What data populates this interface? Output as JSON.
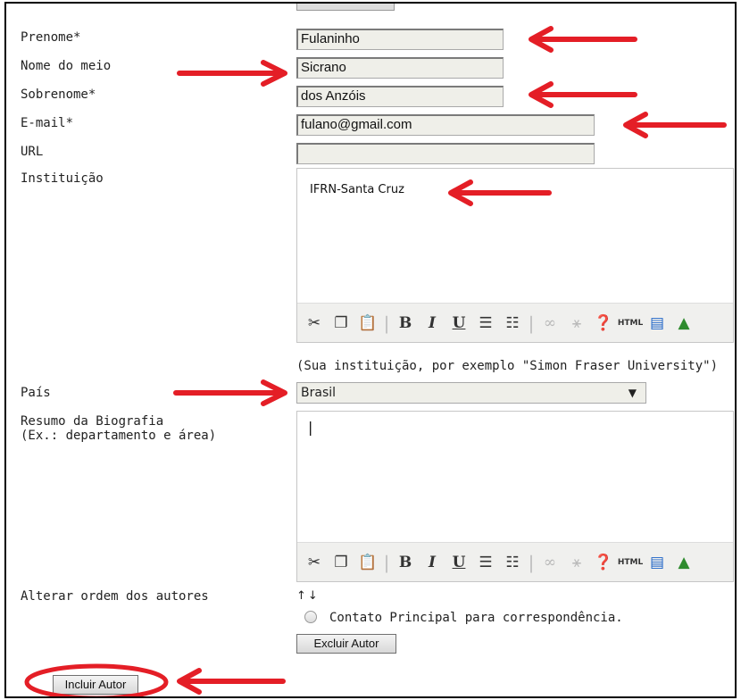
{
  "fields": {
    "prenome": {
      "label": "Prenome*",
      "value": "Fulaninho"
    },
    "nome_meio": {
      "label": "Nome do meio",
      "value": "Sicrano"
    },
    "sobrenome": {
      "label": "Sobrenome*",
      "value": "dos Anzóis"
    },
    "email": {
      "label": "E-mail*",
      "value": "fulano@gmail.com"
    },
    "url": {
      "label": "URL",
      "value": ""
    },
    "instituicao": {
      "label": "Instituição",
      "value": "IFRN-Santa Cruz"
    },
    "instituicao_help": "(Sua instituição, por exemplo \"Simon Fraser University\")",
    "pais": {
      "label": "País",
      "value": "Brasil"
    },
    "biografia": {
      "label_line1": "Resumo da Biografia",
      "label_line2": "(Ex.: departamento e área)",
      "value": "|"
    }
  },
  "order": {
    "label": "Alterar ordem dos autores",
    "arrows": "↑↓"
  },
  "contact": {
    "label": "Contato Principal para correspondência."
  },
  "buttons": {
    "excluir": "Excluir Autor",
    "incluir": "Incluir Autor"
  },
  "colors": {
    "annotation": "#e41e26"
  },
  "toolbar_icons": [
    "cut-icon",
    "copy-icon",
    "paste-icon",
    "bold-icon",
    "italic-icon",
    "underline-icon",
    "bullet-list-icon",
    "numbered-list-icon",
    "link-icon",
    "unlink-icon",
    "help-icon",
    "html-icon",
    "fullscreen-icon",
    "image-upload-icon"
  ]
}
